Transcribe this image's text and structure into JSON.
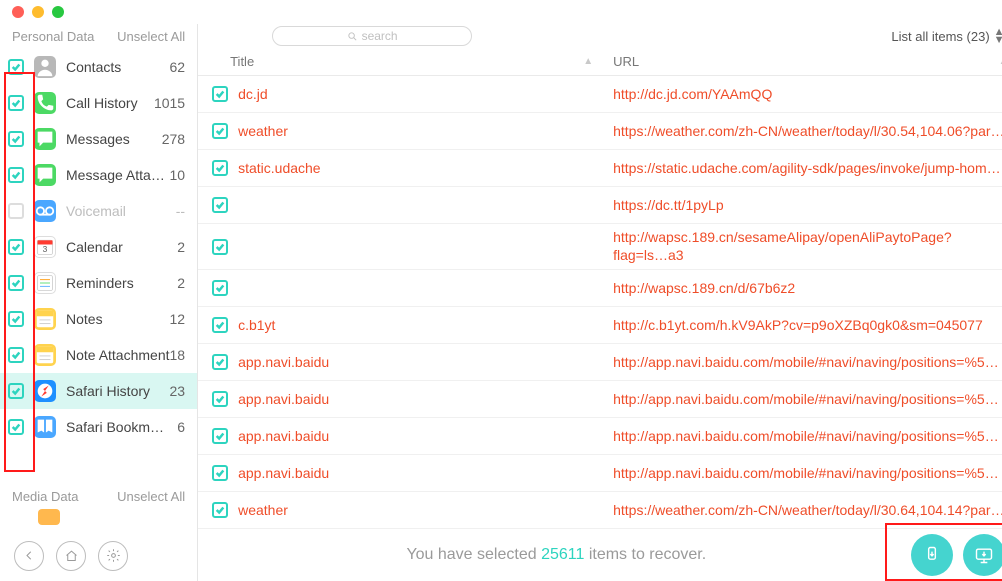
{
  "search": {
    "placeholder": "search"
  },
  "list_selector": "List all items (23)",
  "sidebar": {
    "section1": {
      "title": "Personal Data",
      "action": "Unselect All"
    },
    "section2": {
      "title": "Media Data",
      "action": "Unselect All"
    },
    "categories": [
      {
        "label": "Contacts",
        "count": "62",
        "icon_bg": "#b8b8b8",
        "glyph": "person",
        "checked": true
      },
      {
        "label": "Call History",
        "count": "1015",
        "icon_bg": "#4cd964",
        "glyph": "phone",
        "checked": true
      },
      {
        "label": "Messages",
        "count": "278",
        "icon_bg": "#4cd964",
        "glyph": "bubble",
        "checked": true
      },
      {
        "label": "Message Atta…",
        "count": "10",
        "icon_bg": "#4cd964",
        "glyph": "bubble",
        "checked": true
      },
      {
        "label": "Voicemail",
        "count": "--",
        "icon_bg": "#4aa7ff",
        "glyph": "voicemail",
        "checked": false,
        "disabled": true
      },
      {
        "label": "Calendar",
        "count": "2",
        "icon_bg": "#ffffff",
        "glyph": "cal",
        "checked": true
      },
      {
        "label": "Reminders",
        "count": "2",
        "icon_bg": "#ffffff",
        "glyph": "rem",
        "checked": true
      },
      {
        "label": "Notes",
        "count": "12",
        "icon_bg": "#ffd34e",
        "glyph": "notes",
        "checked": true
      },
      {
        "label": "Note Attachment",
        "count": "18",
        "icon_bg": "#ffd34e",
        "glyph": "notes",
        "checked": true
      },
      {
        "label": "Safari History",
        "count": "23",
        "icon_bg": "#1e90ff",
        "glyph": "safari",
        "checked": true,
        "selected": true
      },
      {
        "label": "Safari Bookm…",
        "count": "6",
        "icon_bg": "#4aa7ff",
        "glyph": "book",
        "checked": true
      }
    ]
  },
  "columns": {
    "title": "Title",
    "url": "URL"
  },
  "rows": [
    {
      "title": "dc.jd",
      "url": "http://dc.jd.com/YAAmQQ"
    },
    {
      "title": "weather",
      "url": "https://weather.com/zh-CN/weather/today/l/30.54,104.06?par…"
    },
    {
      "title": "static.udache",
      "url": "https://static.udache.com/agility-sdk/pages/invoke/jump-hom…"
    },
    {
      "title": "",
      "url": "https://dc.tt/1pyLp"
    },
    {
      "title": "",
      "url": "http://wapsc.189.cn/sesameAlipay/openAliPaytoPage?flag=ls…a3",
      "tall": true
    },
    {
      "title": "",
      "url": "http://wapsc.189.cn/d/67b6z2"
    },
    {
      "title": "c.b1yt",
      "url": "http://c.b1yt.com/h.kV9AkP?cv=p9oXZBq0gk0&sm=045077"
    },
    {
      "title": "app.navi.baidu",
      "url": "http://app.navi.baidu.com/mobile/#navi/naving/positions=%5…"
    },
    {
      "title": "app.navi.baidu",
      "url": "http://app.navi.baidu.com/mobile/#navi/naving/positions=%5…"
    },
    {
      "title": "app.navi.baidu",
      "url": "http://app.navi.baidu.com/mobile/#navi/naving/positions=%5…"
    },
    {
      "title": "app.navi.baidu",
      "url": "http://app.navi.baidu.com/mobile/#navi/naving/positions=%5…"
    },
    {
      "title": "weather",
      "url": "https://weather.com/zh-CN/weather/today/l/30.64,104.14?par…"
    }
  ],
  "summary": {
    "pre": "You have selected ",
    "count": "25611",
    "post": " items to recover."
  }
}
